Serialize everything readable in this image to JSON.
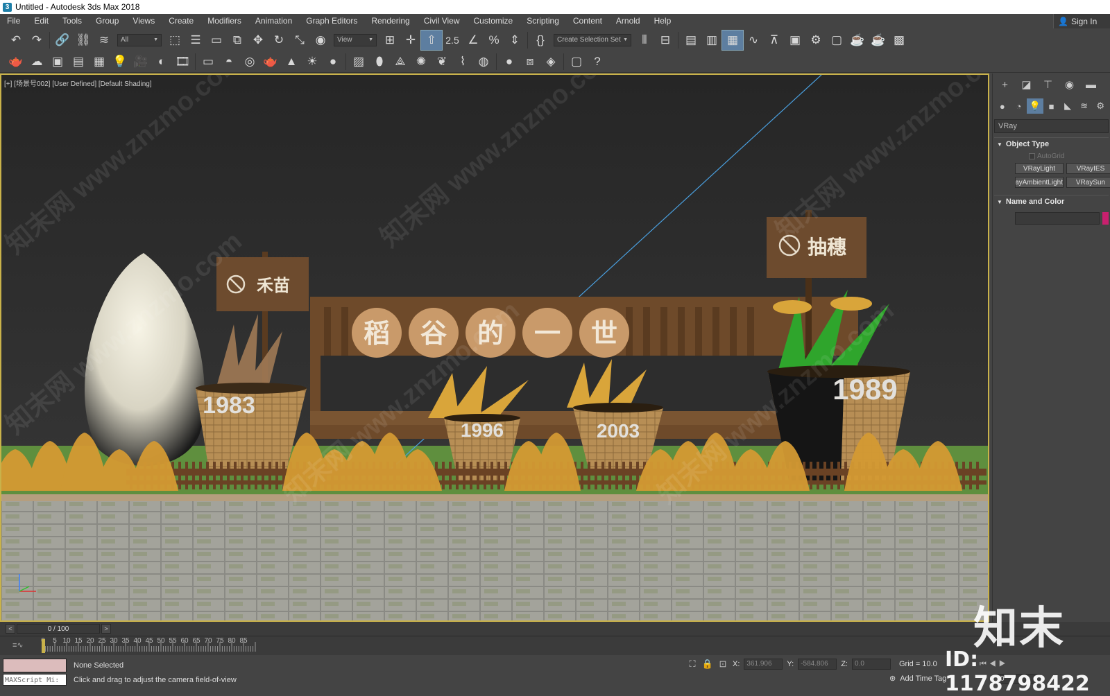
{
  "title_bar": {
    "logo_glyph": "3",
    "title": "Untitled - Autodesk 3ds Max 2018"
  },
  "menu": {
    "items": [
      "File",
      "Edit",
      "Tools",
      "Group",
      "Views",
      "Create",
      "Modifiers",
      "Animation",
      "Graph Editors",
      "Rendering",
      "Civil View",
      "Customize",
      "Scripting",
      "Content",
      "Arnold",
      "Help"
    ],
    "sign_in": "Sign In"
  },
  "toolbar1": {
    "filter_value": "All",
    "refcoord_value": "View",
    "selection_set_value": "Create Selection Set",
    "snap_label": "2.5"
  },
  "viewport": {
    "label": "[+] [场景号002] [User Defined] [Default Shading]",
    "signs": {
      "left": "禾苗",
      "right": "抽穗"
    },
    "fence_title": [
      "稻",
      "谷",
      "的",
      "一",
      "世"
    ],
    "years": [
      "1983",
      "1996",
      "2003",
      "1989"
    ],
    "watermark_text": "知末网 www.znzmo.com"
  },
  "command_panel": {
    "category_dropdown": "VRay",
    "object_type_title": "Object Type",
    "autogrid_label": "AutoGrid",
    "buttons": [
      "VRayLight",
      "VRayIES",
      "VRayAmbientLight",
      "VRaySun"
    ],
    "name_color_title": "Name and Color",
    "name_value": "",
    "object_color": "#c8206e"
  },
  "timeline": {
    "frame_display": "0 / 100",
    "ruler_ticks": [
      "0",
      "5",
      "10",
      "15",
      "20",
      "25",
      "30",
      "35",
      "40",
      "45",
      "50",
      "55",
      "60",
      "65",
      "70",
      "75",
      "80",
      "85"
    ]
  },
  "status": {
    "maxscript_placeholder": "MAXScript Mi:",
    "selection_status": "None Selected",
    "prompt": "Click and drag to adjust the camera field-of-view",
    "x_label": "X:",
    "x_value": "361.906",
    "y_label": "Y:",
    "y_value": "-584.806",
    "z_label": "Z:",
    "z_value": "0.0",
    "grid": "Grid = 10.0",
    "add_time_tag": "Add Time Tag",
    "frame_value": "0"
  },
  "watermark": {
    "logo_text": "知末",
    "id_text": "ID: 1178798422"
  },
  "colors": {
    "viewport_border": "#c9b24a",
    "active_button": "#5d7ea0",
    "grass": "#5f8f3e",
    "wood": "#6e4a2a"
  }
}
